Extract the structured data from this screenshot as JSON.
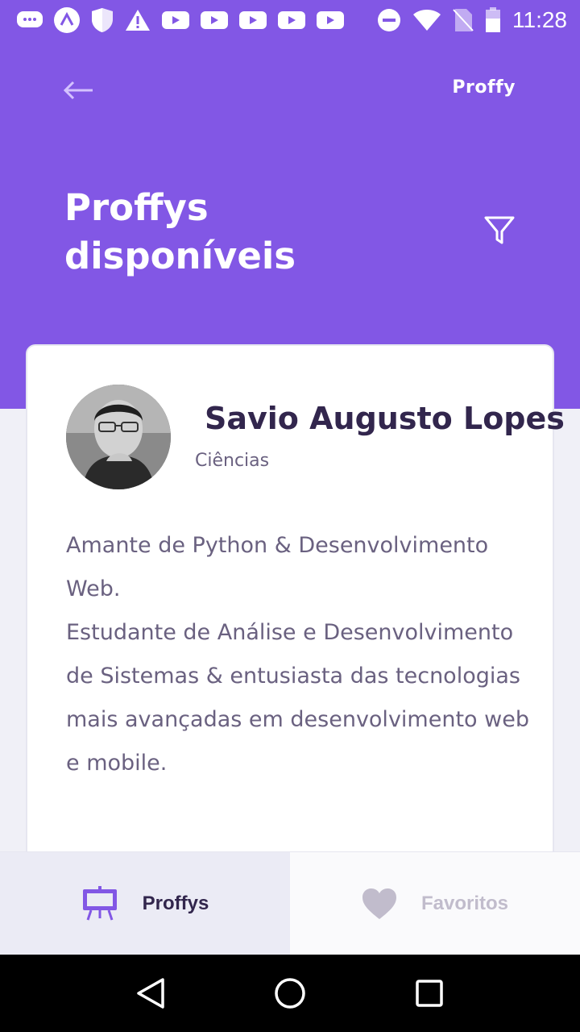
{
  "status_bar": {
    "time": "11:28",
    "left_icons": [
      "chat-icon",
      "app-icon",
      "shield-icon",
      "warning-icon",
      "youtube-icon",
      "youtube-icon",
      "youtube-icon",
      "youtube-icon",
      "youtube-icon"
    ],
    "right_icons": [
      "do-not-disturb-icon",
      "wifi-icon",
      "no-sim-icon",
      "battery-icon"
    ]
  },
  "header": {
    "brand": "Proffy",
    "title": "Proffys disponíveis"
  },
  "teacher_card": {
    "name": "Savio Augusto Lopes",
    "subject": "Ciências",
    "bio": "Amante de Python & Desenvolvimento Web.\nEstudante de Análise e Desenvolvimento  de Sistemas & entusiasta das tecnologias mais avançadas em desenvolvimento web e mobile."
  },
  "tabs": [
    {
      "label": "Proffys",
      "icon": "easel-icon",
      "active": true
    },
    {
      "label": "Favoritos",
      "icon": "heart-icon",
      "active": false
    }
  ],
  "colors": {
    "primary": "#8257e5",
    "title_dark": "#32264d",
    "text_base": "#6a6180",
    "tab_inactive": "#c1bccc"
  }
}
